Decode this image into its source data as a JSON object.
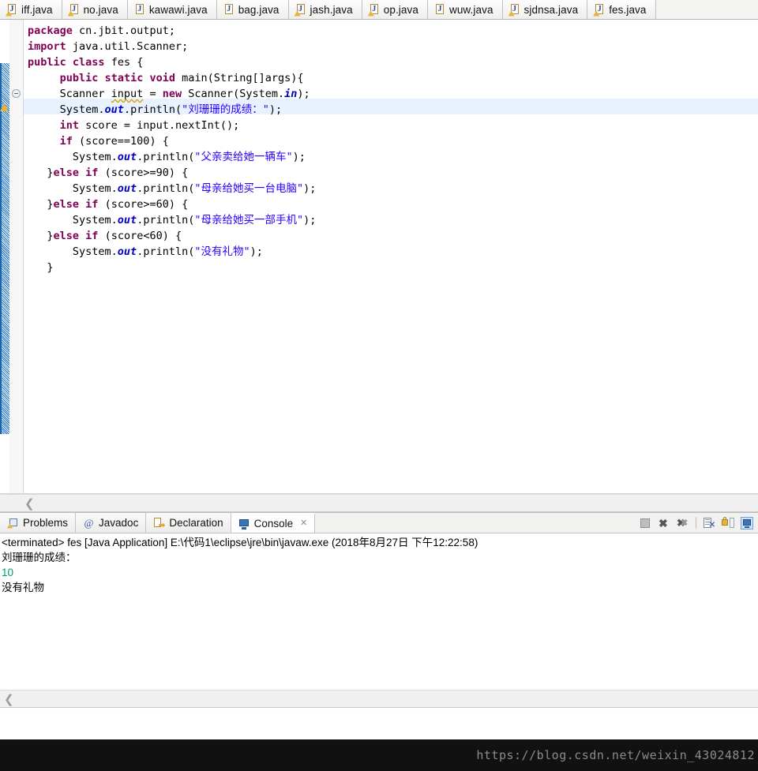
{
  "editor_tabs": [
    {
      "label": "iff.java",
      "icon": "java-file-warning-icon",
      "warning": true,
      "active": false
    },
    {
      "label": "no.java",
      "icon": "java-file-warning-icon",
      "warning": true,
      "active": false
    },
    {
      "label": "kawawi.java",
      "icon": "java-file-icon",
      "warning": false,
      "active": false
    },
    {
      "label": "bag.java",
      "icon": "java-file-icon",
      "warning": false,
      "active": false
    },
    {
      "label": "jash.java",
      "icon": "java-file-warning-icon",
      "warning": true,
      "active": false
    },
    {
      "label": "op.java",
      "icon": "java-file-warning-icon",
      "warning": true,
      "active": false
    },
    {
      "label": "wuw.java",
      "icon": "java-file-icon",
      "warning": false,
      "active": false
    },
    {
      "label": "sjdnsa.java",
      "icon": "java-file-warning-icon",
      "warning": true,
      "active": false
    },
    {
      "label": "fes.java",
      "icon": "java-file-warning-icon",
      "warning": true,
      "active": true
    }
  ],
  "editor": {
    "language": "java",
    "current_line_number": 6,
    "code_lines": [
      "package cn.jbit.output;",
      "import java.util.Scanner;",
      "public class fes {",
      "    public static void main(String[]args){",
      "    Scanner input = new Scanner(System.in);",
      "    System.out.println(\"刘珊珊的成绩：\");",
      "    int score = input.nextInt();",
      "    if (score==100) {",
      "      System.out.println(\"父亲卖给她一辆车\");",
      "  }else if (score>=90) {",
      "      System.out.println(\"母亲给她买一台电脑\");",
      "  }else if (score>=60) {",
      "      System.out.println(\"母亲给她买一部手机\");",
      "  }else if (score<60) {",
      "      System.out.println(\"没有礼物\");",
      "  }",
      "    }",
      "}"
    ],
    "colors": {
      "keyword": "#7f0055",
      "string": "#2a00ff",
      "field": "#0000c0",
      "current_line_highlight": "#e8f2fe",
      "background": "#ffffff"
    }
  },
  "view_tabs": [
    {
      "label": "Problems",
      "icon": "problems-icon",
      "active": false,
      "closeable": false
    },
    {
      "label": "Javadoc",
      "icon": "javadoc-at-icon",
      "active": false,
      "closeable": false
    },
    {
      "label": "Declaration",
      "icon": "declaration-icon",
      "active": false,
      "closeable": false
    },
    {
      "label": "Console",
      "icon": "console-icon",
      "active": true,
      "closeable": true,
      "close_glyph": "✕"
    }
  ],
  "console_toolbar": [
    {
      "name": "terminate-button",
      "icon": "stop-square-icon",
      "enabled": false,
      "active": false
    },
    {
      "name": "remove-console-button",
      "icon": "remove-x-icon",
      "enabled": true,
      "active": false
    },
    {
      "name": "remove-all-button",
      "icon": "remove-all-xx-icon",
      "enabled": true,
      "active": false
    },
    {
      "name": "clear-console-button",
      "icon": "clear-console-icon",
      "enabled": true,
      "active": false
    },
    {
      "name": "scroll-lock-button",
      "icon": "scroll-lock-icon",
      "enabled": true,
      "active": false
    },
    {
      "name": "display-console-button",
      "icon": "display-console-icon",
      "enabled": true,
      "active": true
    }
  ],
  "console": {
    "header": "<terminated> fes [Java Application] E:\\代码1\\eclipse\\jre\\bin\\javaw.exe (2018年8月27日 下午12:22:58)",
    "output": [
      {
        "text": "刘珊珊的成绩：",
        "stream": "stdout"
      },
      {
        "text": "10",
        "stream": "stdin"
      },
      {
        "text": "没有礼物",
        "stream": "stdout"
      }
    ],
    "stdin_color": "#00a070"
  },
  "scrollbars": {
    "editor_left_chevron": "❮",
    "console_left_chevron": "❮"
  },
  "watermark": {
    "text": "https://blog.csdn.net/weixin_43024812"
  }
}
